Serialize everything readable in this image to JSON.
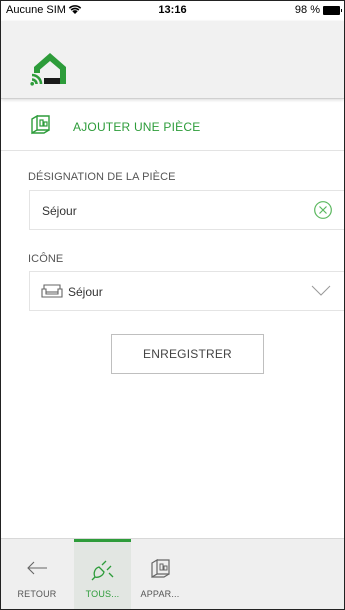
{
  "status_bar": {
    "carrier": "Aucune SIM",
    "time": "13:16",
    "battery": "98 %"
  },
  "header": {
    "logo_icon": "house-signal-logo",
    "brand_color": "#2d9c3a"
  },
  "page": {
    "title": "AJOUTER UNE PIÈCE",
    "title_icon": "room-plan-icon"
  },
  "form": {
    "name_label": "DÉSIGNATION DE LA PIÈCE",
    "name_value": "Séjour",
    "icon_label": "ICÔNE",
    "icon_value": "Séjour",
    "save_label": "ENREGISTRER"
  },
  "tabbar": {
    "items": [
      {
        "label": "RETOUR",
        "icon": "arrow-left-icon",
        "active": false
      },
      {
        "label": "TOUS...",
        "icon": "plug-icon",
        "active": true
      },
      {
        "label": "APPAR...",
        "icon": "room-plan-icon",
        "active": false
      }
    ]
  }
}
